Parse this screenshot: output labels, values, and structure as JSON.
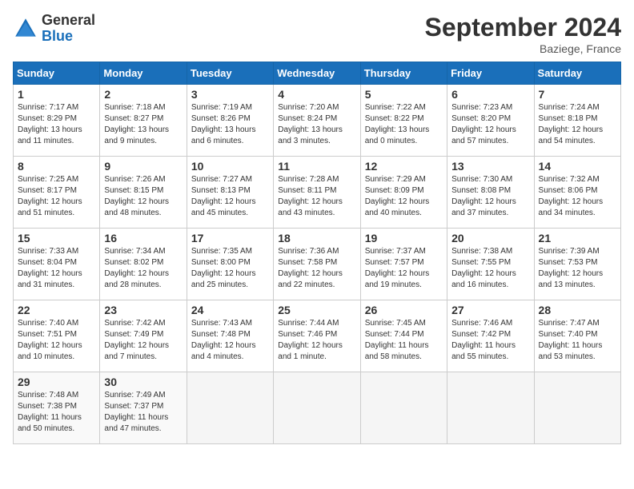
{
  "header": {
    "title": "September 2024",
    "location": "Baziege, France",
    "logo_general": "General",
    "logo_blue": "Blue"
  },
  "days_of_week": [
    "Sunday",
    "Monday",
    "Tuesday",
    "Wednesday",
    "Thursday",
    "Friday",
    "Saturday"
  ],
  "weeks": [
    [
      {
        "day": 1,
        "info": "Sunrise: 7:17 AM\nSunset: 8:29 PM\nDaylight: 13 hours\nand 11 minutes."
      },
      {
        "day": 2,
        "info": "Sunrise: 7:18 AM\nSunset: 8:27 PM\nDaylight: 13 hours\nand 9 minutes."
      },
      {
        "day": 3,
        "info": "Sunrise: 7:19 AM\nSunset: 8:26 PM\nDaylight: 13 hours\nand 6 minutes."
      },
      {
        "day": 4,
        "info": "Sunrise: 7:20 AM\nSunset: 8:24 PM\nDaylight: 13 hours\nand 3 minutes."
      },
      {
        "day": 5,
        "info": "Sunrise: 7:22 AM\nSunset: 8:22 PM\nDaylight: 13 hours\nand 0 minutes."
      },
      {
        "day": 6,
        "info": "Sunrise: 7:23 AM\nSunset: 8:20 PM\nDaylight: 12 hours\nand 57 minutes."
      },
      {
        "day": 7,
        "info": "Sunrise: 7:24 AM\nSunset: 8:18 PM\nDaylight: 12 hours\nand 54 minutes."
      }
    ],
    [
      {
        "day": 8,
        "info": "Sunrise: 7:25 AM\nSunset: 8:17 PM\nDaylight: 12 hours\nand 51 minutes."
      },
      {
        "day": 9,
        "info": "Sunrise: 7:26 AM\nSunset: 8:15 PM\nDaylight: 12 hours\nand 48 minutes."
      },
      {
        "day": 10,
        "info": "Sunrise: 7:27 AM\nSunset: 8:13 PM\nDaylight: 12 hours\nand 45 minutes."
      },
      {
        "day": 11,
        "info": "Sunrise: 7:28 AM\nSunset: 8:11 PM\nDaylight: 12 hours\nand 43 minutes."
      },
      {
        "day": 12,
        "info": "Sunrise: 7:29 AM\nSunset: 8:09 PM\nDaylight: 12 hours\nand 40 minutes."
      },
      {
        "day": 13,
        "info": "Sunrise: 7:30 AM\nSunset: 8:08 PM\nDaylight: 12 hours\nand 37 minutes."
      },
      {
        "day": 14,
        "info": "Sunrise: 7:32 AM\nSunset: 8:06 PM\nDaylight: 12 hours\nand 34 minutes."
      }
    ],
    [
      {
        "day": 15,
        "info": "Sunrise: 7:33 AM\nSunset: 8:04 PM\nDaylight: 12 hours\nand 31 minutes."
      },
      {
        "day": 16,
        "info": "Sunrise: 7:34 AM\nSunset: 8:02 PM\nDaylight: 12 hours\nand 28 minutes."
      },
      {
        "day": 17,
        "info": "Sunrise: 7:35 AM\nSunset: 8:00 PM\nDaylight: 12 hours\nand 25 minutes."
      },
      {
        "day": 18,
        "info": "Sunrise: 7:36 AM\nSunset: 7:58 PM\nDaylight: 12 hours\nand 22 minutes."
      },
      {
        "day": 19,
        "info": "Sunrise: 7:37 AM\nSunset: 7:57 PM\nDaylight: 12 hours\nand 19 minutes."
      },
      {
        "day": 20,
        "info": "Sunrise: 7:38 AM\nSunset: 7:55 PM\nDaylight: 12 hours\nand 16 minutes."
      },
      {
        "day": 21,
        "info": "Sunrise: 7:39 AM\nSunset: 7:53 PM\nDaylight: 12 hours\nand 13 minutes."
      }
    ],
    [
      {
        "day": 22,
        "info": "Sunrise: 7:40 AM\nSunset: 7:51 PM\nDaylight: 12 hours\nand 10 minutes."
      },
      {
        "day": 23,
        "info": "Sunrise: 7:42 AM\nSunset: 7:49 PM\nDaylight: 12 hours\nand 7 minutes."
      },
      {
        "day": 24,
        "info": "Sunrise: 7:43 AM\nSunset: 7:48 PM\nDaylight: 12 hours\nand 4 minutes."
      },
      {
        "day": 25,
        "info": "Sunrise: 7:44 AM\nSunset: 7:46 PM\nDaylight: 12 hours\nand 1 minute."
      },
      {
        "day": 26,
        "info": "Sunrise: 7:45 AM\nSunset: 7:44 PM\nDaylight: 11 hours\nand 58 minutes."
      },
      {
        "day": 27,
        "info": "Sunrise: 7:46 AM\nSunset: 7:42 PM\nDaylight: 11 hours\nand 55 minutes."
      },
      {
        "day": 28,
        "info": "Sunrise: 7:47 AM\nSunset: 7:40 PM\nDaylight: 11 hours\nand 53 minutes."
      }
    ],
    [
      {
        "day": 29,
        "info": "Sunrise: 7:48 AM\nSunset: 7:38 PM\nDaylight: 11 hours\nand 50 minutes."
      },
      {
        "day": 30,
        "info": "Sunrise: 7:49 AM\nSunset: 7:37 PM\nDaylight: 11 hours\nand 47 minutes."
      },
      null,
      null,
      null,
      null,
      null
    ]
  ]
}
